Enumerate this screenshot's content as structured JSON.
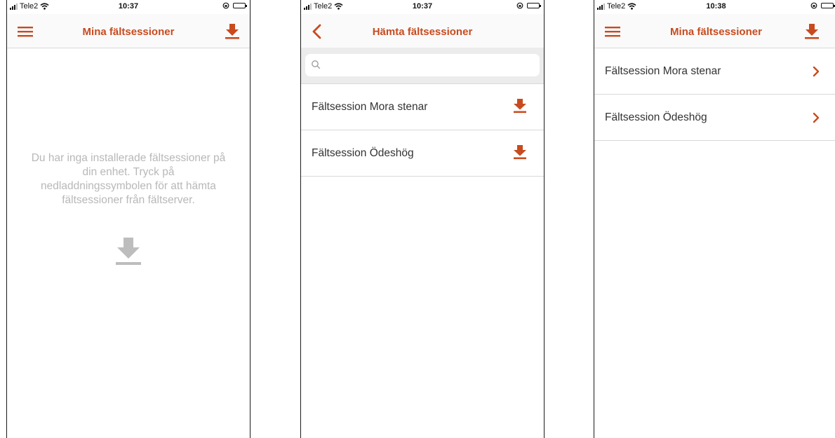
{
  "colors": {
    "accent": "#c84b1f",
    "muted": "#b8b8b8",
    "divider": "#d9d9d9"
  },
  "screens": [
    {
      "status": {
        "carrier": "Tele2",
        "time": "10:37"
      },
      "nav": {
        "title": "Mina fältsessioner",
        "left_icon": "hamburger-menu-icon",
        "right_icon": "download-icon"
      },
      "empty_message": "Du har inga installerade fältsessioner på din enhet. Tryck på nedladdningssymbolen för att hämta fältsessioner från fältserver.",
      "empty_icon": "download-icon"
    },
    {
      "status": {
        "carrier": "Tele2",
        "time": "10:37"
      },
      "nav": {
        "title": "Hämta fältsessioner",
        "left_icon": "back-chevron-icon"
      },
      "search": {
        "placeholder": "",
        "value": ""
      },
      "items": [
        {
          "label": "Fältsession Mora stenar",
          "icon": "download-icon"
        },
        {
          "label": "Fältsession Ödeshög",
          "icon": "download-icon"
        }
      ]
    },
    {
      "status": {
        "carrier": "Tele2",
        "time": "10:38"
      },
      "nav": {
        "title": "Mina fältsessioner",
        "left_icon": "hamburger-menu-icon",
        "right_icon": "download-icon"
      },
      "items": [
        {
          "label": "Fältsession Mora stenar",
          "icon": "chevron-right-icon"
        },
        {
          "label": "Fältsession Ödeshög",
          "icon": "chevron-right-icon"
        }
      ]
    }
  ]
}
